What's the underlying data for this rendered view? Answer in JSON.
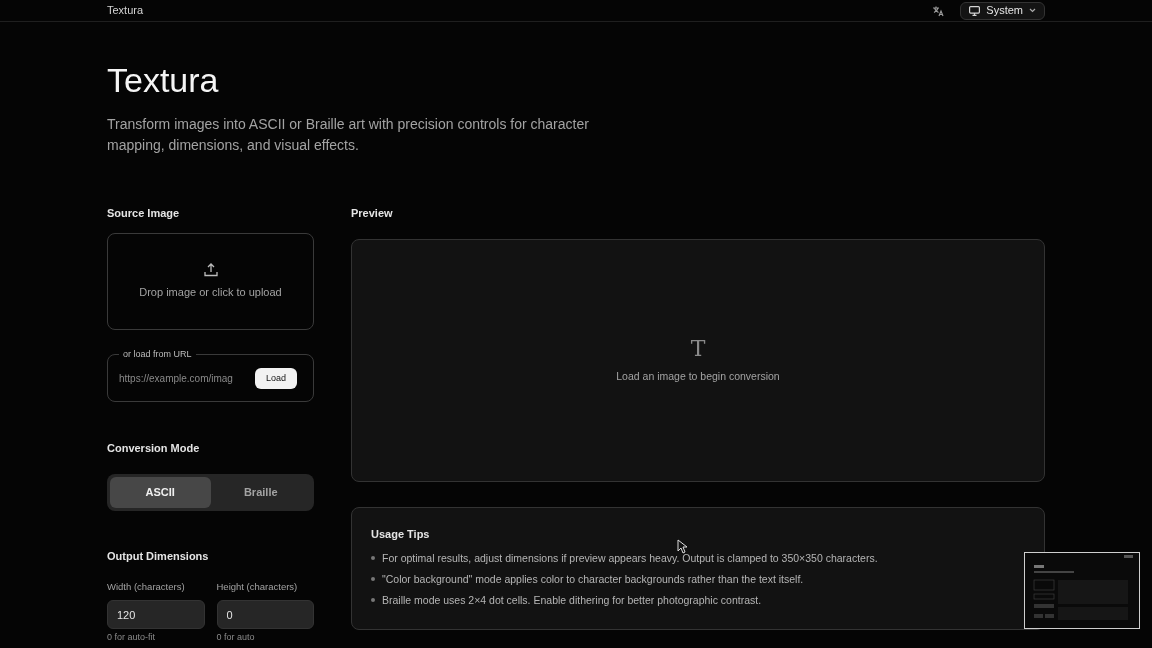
{
  "header": {
    "brand": "Textura",
    "theme_select": "System"
  },
  "title": "Textura",
  "subtitle": "Transform images into ASCII or Braille art with precision controls for character mapping, dimensions, and visual effects.",
  "source": {
    "label": "Source Image",
    "dropzone": "Drop image or click to upload",
    "url_legend": "or load from URL",
    "url_placeholder": "https://example.com/imag",
    "load_button": "Load"
  },
  "mode": {
    "label": "Conversion Mode",
    "options": [
      {
        "label": "ASCII",
        "selected": true
      },
      {
        "label": "Braille",
        "selected": false
      }
    ]
  },
  "dimensions": {
    "label": "Output Dimensions",
    "fields": [
      {
        "label": "Width (characters)",
        "value": "120",
        "hint": "0 for auto-fit"
      },
      {
        "label": "Height (characters)",
        "value": "0",
        "hint": "0 for auto"
      }
    ]
  },
  "preview": {
    "label": "Preview",
    "placeholder_glyph": "T",
    "message": "Load an image to begin conversion"
  },
  "tips": {
    "title": "Usage Tips",
    "items": [
      "For optimal results, adjust dimensions if preview appears heavy. Output is clamped to 350×350 characters.",
      "\"Color background\" mode applies color to character backgrounds rather than the text itself.",
      "Braille mode uses 2×4 dot cells. Enable dithering for better photographic contrast."
    ]
  }
}
